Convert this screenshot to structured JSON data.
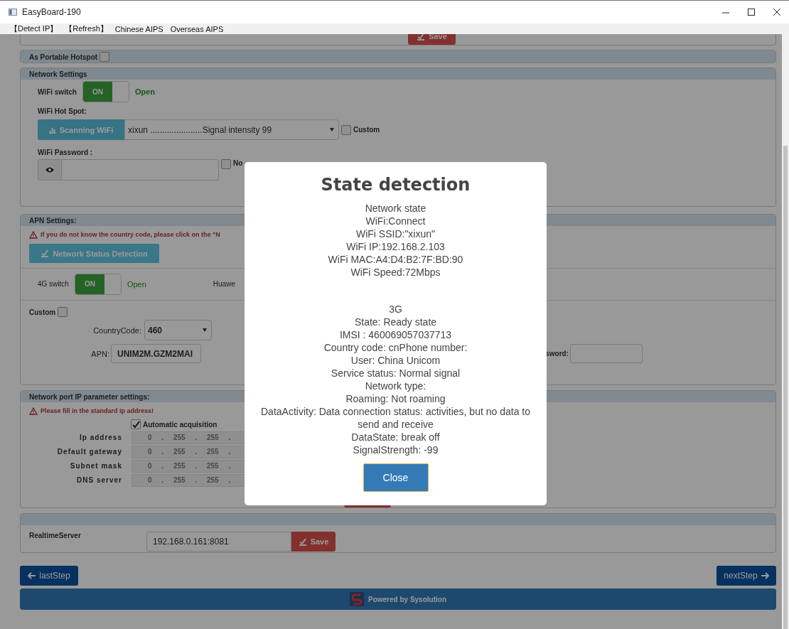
{
  "window": {
    "title": "EasyBoard-190"
  },
  "menu": [
    "【Detect IP】",
    "【Refresh】",
    "Chinese AIPS",
    "Overseas AIPS"
  ],
  "top_panel": {
    "save_button": "Save"
  },
  "hotspot_panel": {
    "title": "As Portable Hotspot",
    "checked": false
  },
  "network_settings": {
    "title": "Network Settings",
    "wifi_switch": {
      "label": "WiFi switch",
      "on": true,
      "text": "ON",
      "status": "Open"
    },
    "hot_spot_label": "WiFi Hot Spot:",
    "scan_button": "Scanning WiFi",
    "hotspot_select": "xixun ......................Signal intensity 99",
    "custom": {
      "label": "Custom",
      "checked": false
    },
    "password_label": "WiFi Password :",
    "no_checkbox": {
      "label": "No",
      "checked": false
    }
  },
  "apn_settings": {
    "title": "APN Settings:",
    "warning": "If you do not know the country code, please click on the \"N",
    "detect_button": "Network Status Detection",
    "switch_4g": {
      "label": "4G switch",
      "on": true,
      "text": "ON",
      "status": "Open"
    },
    "huawei_label": "Huawe",
    "custom": {
      "label": "Custom",
      "checked": false
    },
    "country_code": {
      "label": "CountryCode:",
      "value": "460"
    },
    "apn": {
      "label": "APN:",
      "value": "UNIM2M.GZM2MAI"
    },
    "password_label": "sword:"
  },
  "ip_settings": {
    "title": "Network port IP parameter settings:",
    "warning": "Please fill in the standard Ip address!",
    "auto": {
      "label": "Automatic acquisition",
      "checked": true
    },
    "rows": [
      {
        "label": "Ip address",
        "value": "0 . 255 . 255 ."
      },
      {
        "label": "Default gateway",
        "value": "0 . 255 . 255 ."
      },
      {
        "label": "Subnet mask",
        "value": "0 . 255 . 255 ."
      },
      {
        "label": "DNS server",
        "value": "0 . 255 . 255 ."
      }
    ]
  },
  "realtime": {
    "label": "RealtimeServer",
    "value": "192.168.0.161:8081",
    "save_button": "Save"
  },
  "nav": {
    "back": "lastStep",
    "next": "nextStep"
  },
  "footer": {
    "text": "Powered by Sysolution"
  },
  "modal": {
    "title": "State detection",
    "sections": [
      {
        "lines": [
          "Network state",
          "WiFi:Connect",
          "WiFi SSID:\"xixun\"",
          "WiFi IP:192.168.2.103",
          "WiFi MAC:A4:D4:B2:7F:BD:90",
          "WiFi Speed:72Mbps"
        ]
      },
      {
        "lines": [
          "3G",
          "State: Ready state",
          "IMSI : 460069057037713",
          "Country code: cnPhone number:",
          "User: China Unicom",
          "Service status: Normal signal",
          "Network type:",
          "Roaming: Not roaming",
          "DataActivity: Data connection status: activities, but no data to send and receive",
          "DataState: break off",
          "SignalStrength: -99"
        ]
      }
    ],
    "close_button": "Close"
  }
}
